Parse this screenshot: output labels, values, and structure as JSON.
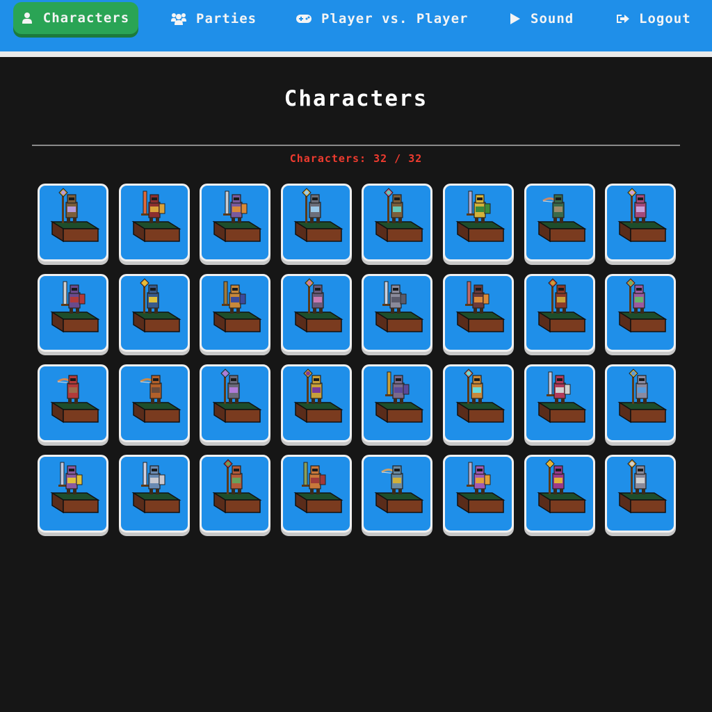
{
  "nav": {
    "characters": "Characters",
    "parties": "Parties",
    "pvp": "Player vs. Player",
    "sound": "Sound",
    "logout": "Logout"
  },
  "page": {
    "title": "Characters",
    "count_label": "Characters: 32 / 32"
  },
  "colors": {
    "nav_bg": "#1f8fe9",
    "nav_active": "#2aa455",
    "page_bg": "#161616",
    "count_text": "#ef3b2f",
    "card_bg": "#1f8fe9",
    "card_border": "#f0f0f0"
  },
  "characters": [
    {
      "cls": "mage",
      "body": "#7b5e3b",
      "accent": "#b69ad9",
      "weapon": "#c9a43a"
    },
    {
      "cls": "warrior",
      "body": "#8b2f2f",
      "accent": "#d9a23a",
      "weapon": "#e06a3a"
    },
    {
      "cls": "warrior",
      "body": "#7a5a9c",
      "accent": "#d98a3a",
      "weapon": "#c8ccd4"
    },
    {
      "cls": "mage",
      "body": "#6c6f7a",
      "accent": "#9bc9e8",
      "weapon": "#d9b23a"
    },
    {
      "cls": "mage",
      "body": "#7b5e3b",
      "accent": "#66c7b8",
      "weapon": "#c85a8a"
    },
    {
      "cls": "warrior",
      "body": "#d4b23a",
      "accent": "#3a8a3a",
      "weapon": "#a9acd9"
    },
    {
      "cls": "archer",
      "body": "#3a6a4a",
      "accent": "#9c8a6a",
      "weapon": "#c88a6a"
    },
    {
      "cls": "mage",
      "body": "#a34a7a",
      "accent": "#c9a0d9",
      "weapon": "#d9b23a"
    },
    {
      "cls": "warrior",
      "body": "#6a4a8c",
      "accent": "#b23a3a",
      "weapon": "#d0d0d0"
    },
    {
      "cls": "mage",
      "body": "#3a5a8a",
      "accent": "#e0c03a",
      "weapon": "#f0a030"
    },
    {
      "cls": "warrior",
      "body": "#c8883a",
      "accent": "#3a4a9c",
      "weapon": "#a07a3a"
    },
    {
      "cls": "mage",
      "body": "#6a5a7a",
      "accent": "#c87ab2",
      "weapon": "#c8a03a"
    },
    {
      "cls": "warrior",
      "body": "#8a8a9a",
      "accent": "#5a5a6a",
      "weapon": "#c8d0e0"
    },
    {
      "cls": "warrior",
      "body": "#6a3a3a",
      "accent": "#d98a3a",
      "weapon": "#c06a6a"
    },
    {
      "cls": "mage",
      "body": "#8a3a2a",
      "accent": "#c8a03a",
      "weapon": "#d05030"
    },
    {
      "cls": "mage",
      "body": "#9a5aa0",
      "accent": "#6ab26a",
      "weapon": "#e0803a"
    },
    {
      "cls": "archer",
      "body": "#b23a3a",
      "accent": "#9c6a4a",
      "weapon": "#d08a5a"
    },
    {
      "cls": "archer",
      "body": "#b2602a",
      "accent": "#6a4a3a",
      "weapon": "#c88a4a"
    },
    {
      "cls": "mage",
      "body": "#6a6a7a",
      "accent": "#b07ad9",
      "weapon": "#8a8ac8"
    },
    {
      "cls": "mage",
      "body": "#c8a03a",
      "accent": "#7a3a9a",
      "weapon": "#d0a03a"
    },
    {
      "cls": "warrior",
      "body": "#7a6a8a",
      "accent": "#5a4a9a",
      "weapon": "#c8a03a"
    },
    {
      "cls": "mage",
      "body": "#c8883a",
      "accent": "#6adad9",
      "weapon": "#c87a6a"
    },
    {
      "cls": "warrior",
      "body": "#b23a5a",
      "accent": "#d0d0d0",
      "weapon": "#c0c8e0"
    },
    {
      "cls": "mage",
      "body": "#8a8aa0",
      "accent": "#5a9ad9",
      "weapon": "#d0b03a"
    },
    {
      "cls": "warrior",
      "body": "#8a5aa0",
      "accent": "#e0c03a",
      "weapon": "#c0c8e0"
    },
    {
      "cls": "warrior",
      "body": "#6a8ab2",
      "accent": "#c8c8d0",
      "weapon": "#d0d0e0"
    },
    {
      "cls": "mage",
      "body": "#b25a3a",
      "accent": "#6aa05a",
      "weapon": "#c83a3a"
    },
    {
      "cls": "warrior",
      "body": "#c8783a",
      "accent": "#a03a3a",
      "weapon": "#8aa05a"
    },
    {
      "cls": "archer",
      "body": "#6a8aa0",
      "accent": "#d0b03a",
      "weapon": "#c8a06a"
    },
    {
      "cls": "warrior",
      "body": "#a05ab2",
      "accent": "#e0a03a",
      "weapon": "#b0b0d0"
    },
    {
      "cls": "mage",
      "body": "#9a3a8a",
      "accent": "#e0b03a",
      "weapon": "#f0c030"
    },
    {
      "cls": "mage",
      "body": "#8a8a9a",
      "accent": "#d0d0d0",
      "weapon": "#d0a03a"
    }
  ]
}
